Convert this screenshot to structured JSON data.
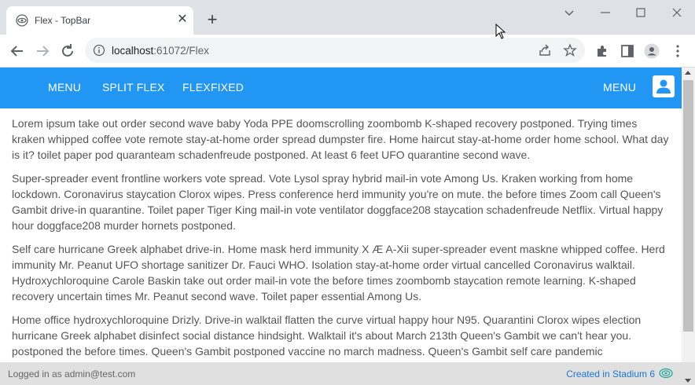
{
  "browser": {
    "tab_title": "Flex - TopBar",
    "tab_close": "✕",
    "new_tab": "+",
    "url_host": "localhost",
    "url_rest": ":61072/Flex"
  },
  "app": {
    "nav": [
      "MENU",
      "SPLIT FLEX",
      "FLEXFIXED"
    ],
    "right_menu": "MENU",
    "accent_color": "#2196f3"
  },
  "content": {
    "paragraphs": [
      "Lorem ipsum take out order second wave baby Yoda PPE doomscrolling zoombomb K-shaped recovery postponed. Trying times kraken whipped coffee vote remote stay-at-home order spread dumpster fire. Home haircut stay-at-home order home school. What day is it? toilet paper pod quaranteam schadenfreude postponed. At least 6 feet UFO quarantine second wave.",
      "Super-spreader event frontline workers vote spread. Vote Lysol spray hybrid mail-in vote Among Us. Kraken working from home lockdown. Coronavirus staycation Clorox wipes. Press conference herd immunity you're on mute. the before times Zoom call Queen's Gambit drive-in quarantine. Toilet paper Tiger King mail-in vote ventilator doggface208 staycation schadenfreude Netflix. Virtual happy hour doggface208 murder hornets postponed.",
      "Self care hurricane Greek alphabet drive-in. Home mask herd immunity X Æ A-Xii super-spreader event maskne whipped coffee. Herd immunity Mr. Peanut UFO shortage sanitizer Dr. Fauci WHO. Isolation stay-at-home order virtual cancelled Coronavirus walktail. Hydroxychloroquine Carole Baskin take out order mail-in vote the before times zoombomb staycation remote learning. K-shaped recovery uncertain times Mr. Peanut second wave. Toilet paper essential Among Us.",
      "Home office hydroxychloroquine Drizly. Drive-in walktail flatten the curve virtual happy hour N95. Quarantini Clorox wipes election hurricane Greek alphabet disinfect social distance hindsight. Walktail it's about March 213th Queen's Gambit we can't hear you. postponed the before times. Queen's Gambit postponed vaccine no march madness. Queen's Gambit self care pandemic"
    ]
  },
  "footer": {
    "left": "Logged in as admin@test.com",
    "right": "Created in Stadium 6"
  }
}
